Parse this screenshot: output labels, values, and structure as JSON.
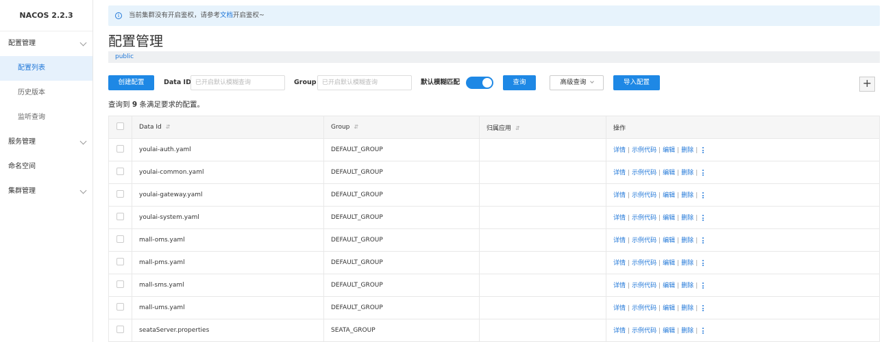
{
  "sidebar": {
    "brand": "NACOS 2.2.3",
    "items": [
      {
        "label": "配置管理"
      },
      {
        "label": "配置列表"
      },
      {
        "label": "历史版本"
      },
      {
        "label": "监听查询"
      },
      {
        "label": "服务管理"
      },
      {
        "label": "命名空间"
      },
      {
        "label": "集群管理"
      }
    ]
  },
  "notice": {
    "text_before": "当前集群没有开启鉴权，请参考",
    "link": "文档",
    "text_after": "开启鉴权~"
  },
  "page_title": "配置管理",
  "namespace": "public",
  "toolbar": {
    "create_label": "创建配置",
    "dataid_label": "Data ID",
    "dataid_placeholder": "已开启默认模糊查询",
    "group_label": "Group",
    "group_placeholder": "已开启默认模糊查询",
    "fuzzy_label": "默认模糊匹配",
    "fuzzy_on": true,
    "query_label": "查询",
    "advanced_label": "高级查询",
    "import_label": "导入配置",
    "plus_label": "+"
  },
  "result": {
    "prefix": "查询到",
    "count": "9",
    "suffix": "条满足要求的配置。"
  },
  "table": {
    "headers": {
      "dataid": "Data Id",
      "group": "Group",
      "app": "归属应用",
      "ops": "操作"
    },
    "sort_icon": "⇵",
    "ops": {
      "detail": "详情",
      "sample": "示例代码",
      "edit": "编辑",
      "delete": "删除",
      "sep": "|"
    },
    "rows": [
      {
        "dataid": "youlai-auth.yaml",
        "group": "DEFAULT_GROUP",
        "app": ""
      },
      {
        "dataid": "youlai-common.yaml",
        "group": "DEFAULT_GROUP",
        "app": ""
      },
      {
        "dataid": "youlai-gateway.yaml",
        "group": "DEFAULT_GROUP",
        "app": ""
      },
      {
        "dataid": "youlai-system.yaml",
        "group": "DEFAULT_GROUP",
        "app": ""
      },
      {
        "dataid": "mall-oms.yaml",
        "group": "DEFAULT_GROUP",
        "app": ""
      },
      {
        "dataid": "mall-pms.yaml",
        "group": "DEFAULT_GROUP",
        "app": ""
      },
      {
        "dataid": "mall-sms.yaml",
        "group": "DEFAULT_GROUP",
        "app": ""
      },
      {
        "dataid": "mall-ums.yaml",
        "group": "DEFAULT_GROUP",
        "app": ""
      },
      {
        "dataid": "seataServer.properties",
        "group": "SEATA_GROUP",
        "app": ""
      }
    ]
  },
  "colors": {
    "primary": "#1e88e5",
    "link": "#2077d8",
    "active_bg": "#e6f1fc",
    "notice_bg": "#e7f3fc"
  }
}
